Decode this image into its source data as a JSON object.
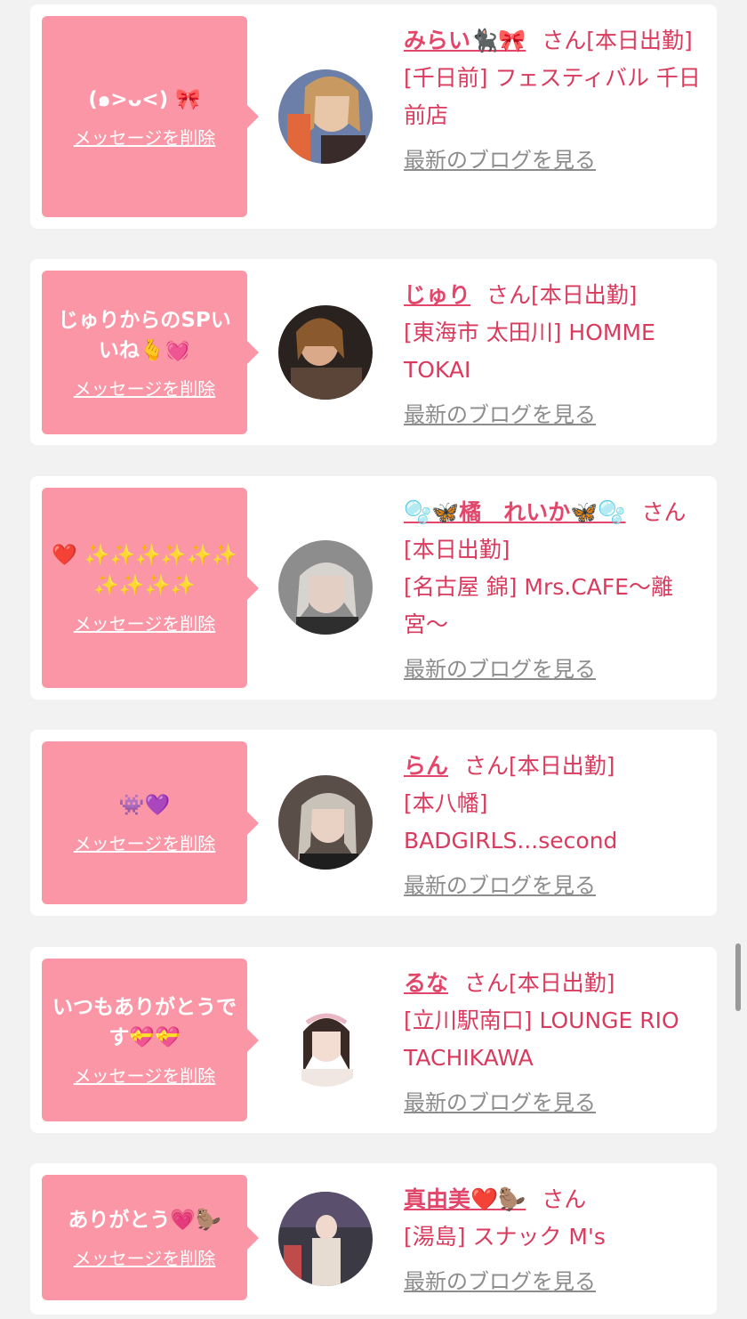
{
  "delete_label": "メッセージを削除",
  "blog_label": "最新のブログを見る",
  "san_suffix": "さん",
  "accent_color": "#fa96a6",
  "name_color": "#e2476b",
  "cards": [
    {
      "message": "(๑>ᴗ<) 🎀",
      "name": "みらい🐈‍⬛🎀",
      "status": "[本日出勤]",
      "shop": "[千日前] フェスティバル 千日前店"
    },
    {
      "message": "じゅりからのSPいいね🫰💓",
      "name": "じゅり",
      "status": "[本日出勤]",
      "shop": "[東海市 太田川] HOMME TOKAI"
    },
    {
      "message": "❤️ ✨✨✨✨✨✨ ✨✨✨✨",
      "name": "🫧🦋橘　れいか🦋🫧",
      "status": "[本日出勤]",
      "shop": "[名古屋 錦] Mrs.CAFE〜離宮〜"
    },
    {
      "message": "👾💜",
      "name": "らん",
      "status": "[本日出勤]",
      "shop": "[本八幡] BADGIRLS...second"
    },
    {
      "message": "いつもありがとうです💝💝",
      "name": "るな",
      "status": "[本日出勤]",
      "shop": "[立川駅南口] LOUNGE RIO TACHIKAWA"
    },
    {
      "message": "ありがとう💗🦫",
      "name": "真由美❤️🦫",
      "status": "",
      "shop": "[湯島] スナック M's"
    }
  ]
}
